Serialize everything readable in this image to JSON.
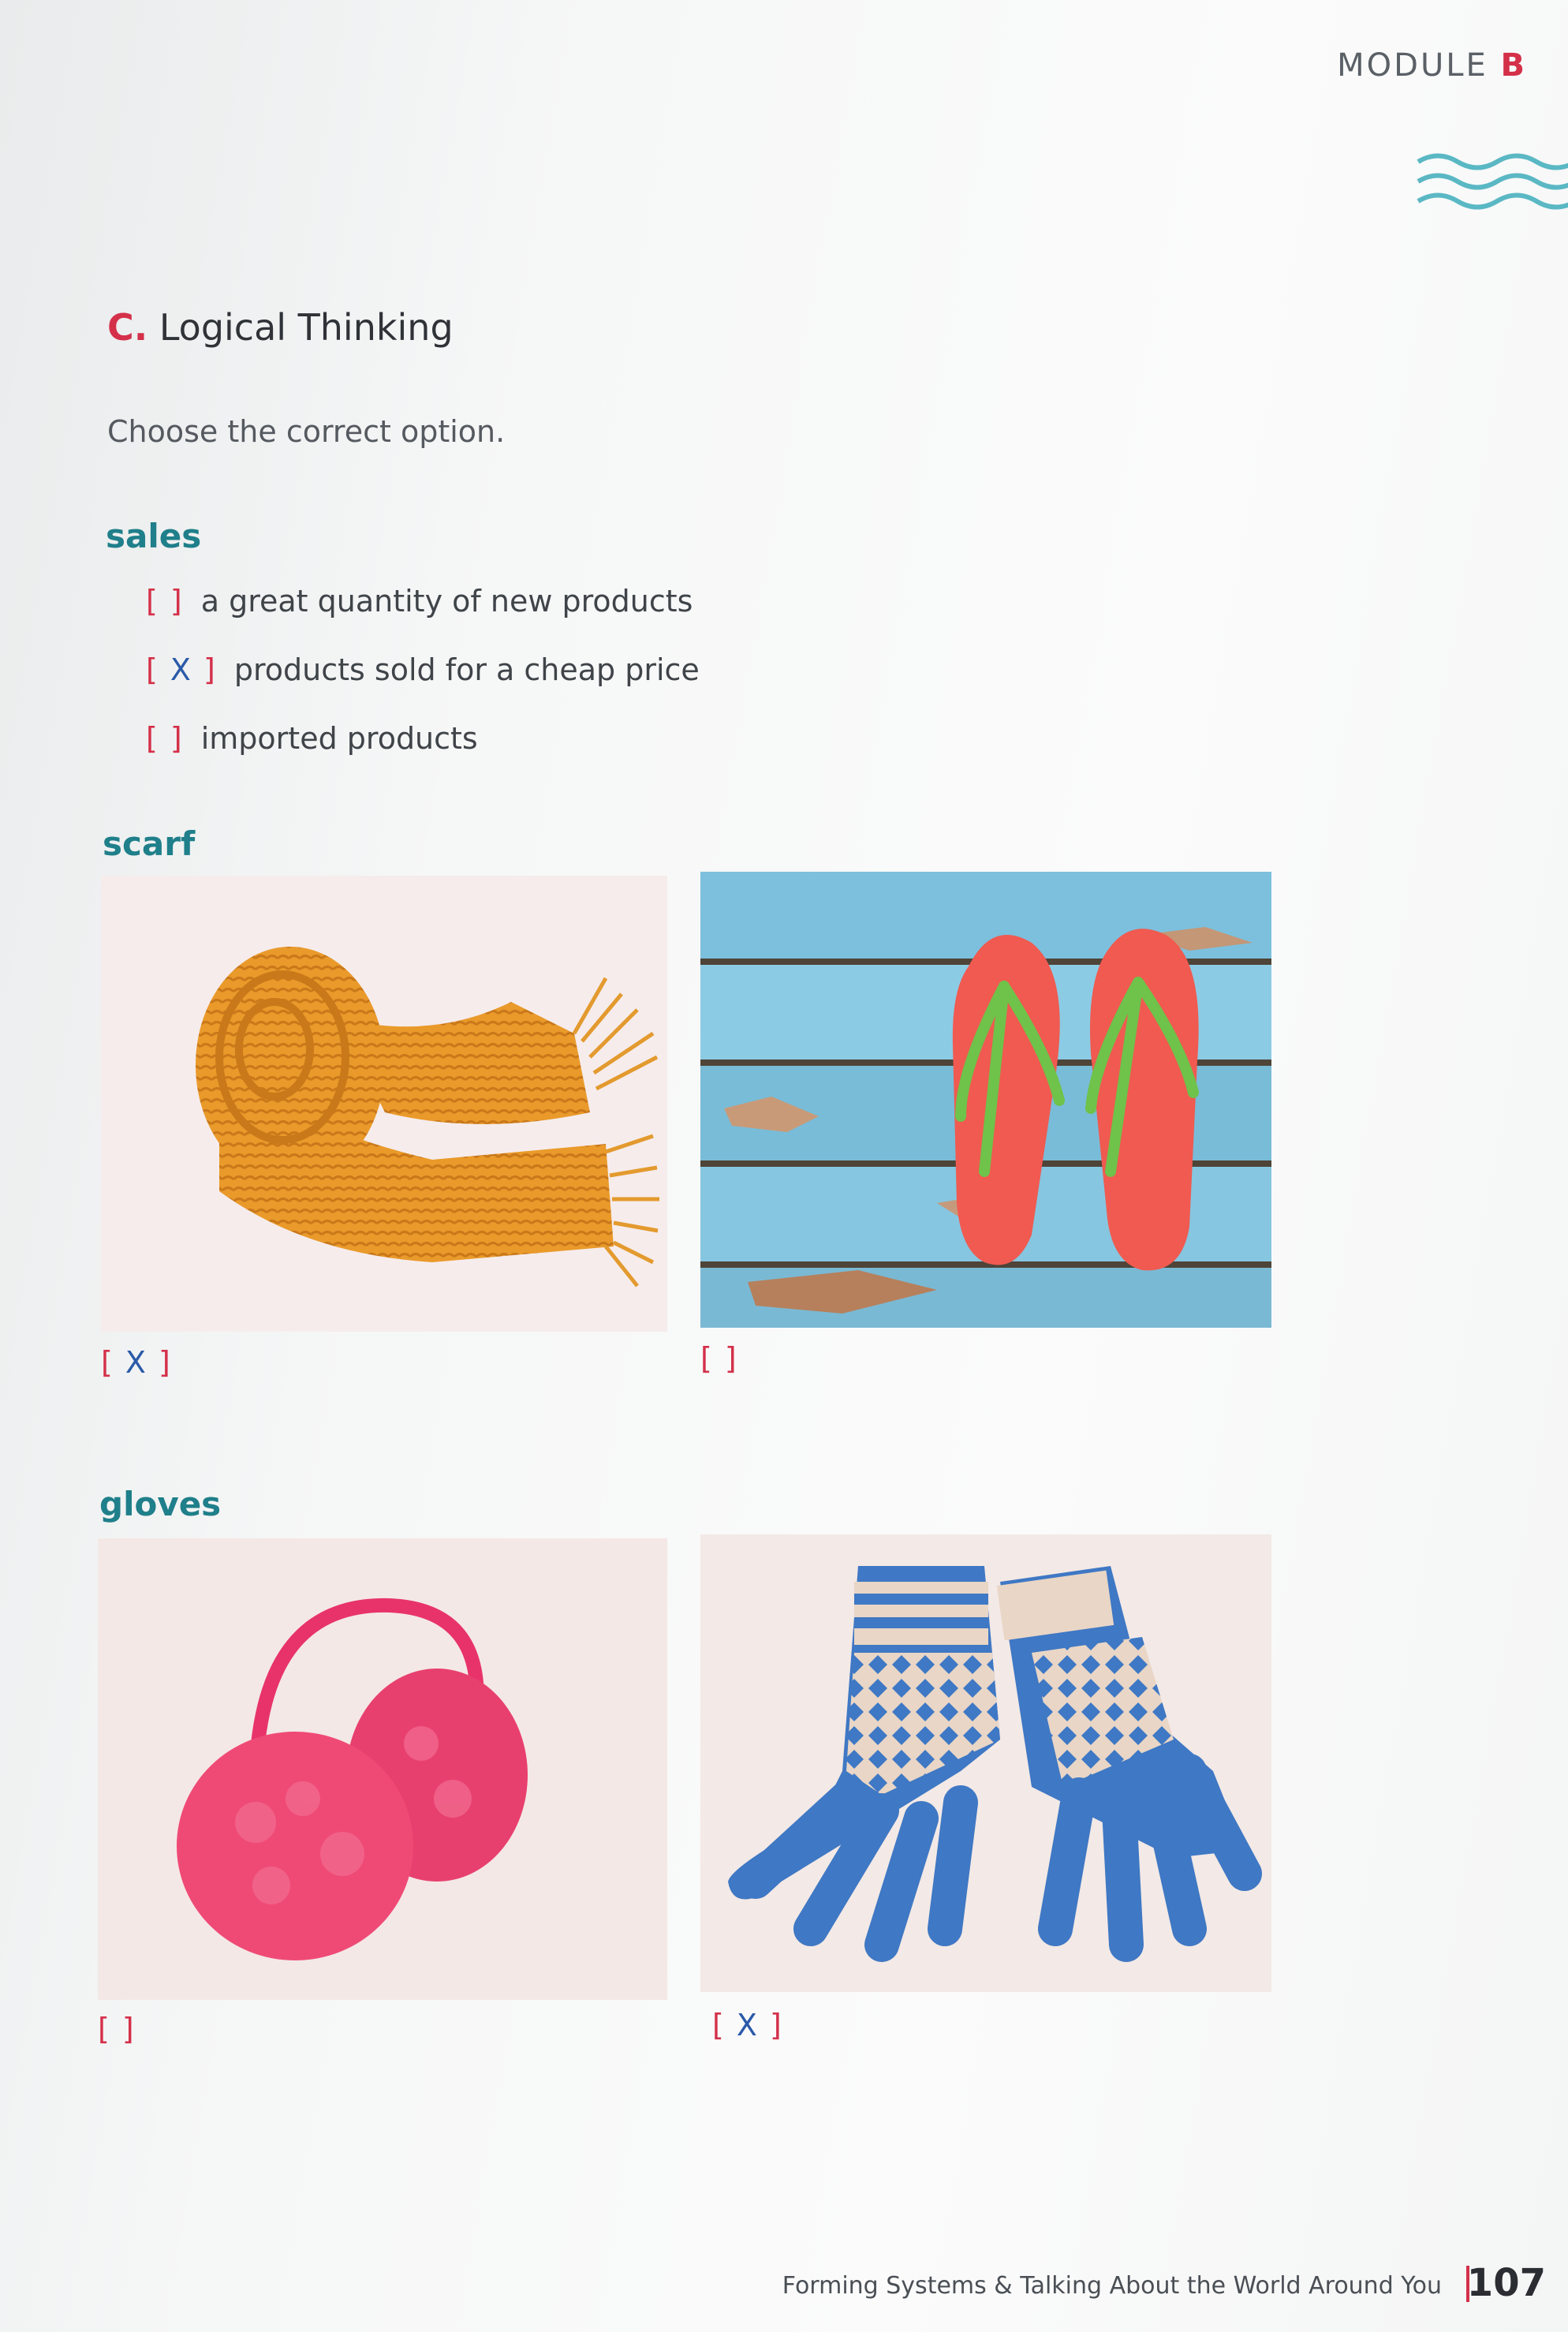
{
  "header": {
    "module_label": "MODULE",
    "module_letter": "B"
  },
  "section": {
    "letter": "C.",
    "title": "Logical Thinking",
    "instruction": "Choose the correct option."
  },
  "questions": {
    "sales": {
      "word": "sales",
      "options": [
        {
          "mark": " ",
          "text": "a great quantity of new products"
        },
        {
          "mark": "X",
          "text": "products sold for a cheap price"
        },
        {
          "mark": " ",
          "text": "imported products"
        }
      ]
    },
    "scarf": {
      "word": "scarf",
      "images": [
        {
          "icon": "knitted-scarf-photo",
          "mark": "X"
        },
        {
          "icon": "flip-flops-photo",
          "mark": " "
        }
      ]
    },
    "gloves": {
      "word": "gloves",
      "images": [
        {
          "icon": "earmuffs-photo",
          "mark": " "
        },
        {
          "icon": "knitted-gloves-photo",
          "mark": "X"
        }
      ]
    }
  },
  "footer": {
    "text": "Forming Systems & Talking About the World Around You",
    "page_number": "107"
  },
  "colors": {
    "accent_red": "#d4304a",
    "teal": "#1f7f8a",
    "answer_blue": "#2a5aa8"
  }
}
